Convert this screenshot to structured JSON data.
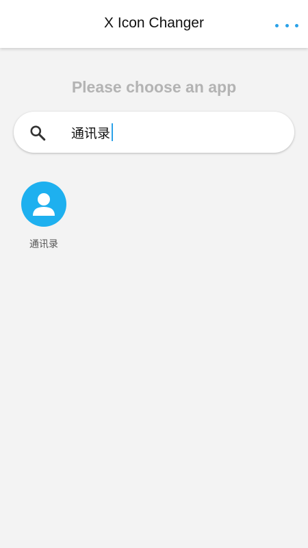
{
  "header": {
    "title": "X Icon Changer",
    "more_icon": "more-horizontal-icon",
    "accent_color": "#2aa1e8"
  },
  "main": {
    "prompt": "Please choose an app",
    "search": {
      "icon": "search-icon",
      "value": "通讯录"
    },
    "apps": [
      {
        "label": "通讯录",
        "icon": "contacts-icon",
        "icon_color": "#1eb0ef"
      }
    ]
  }
}
